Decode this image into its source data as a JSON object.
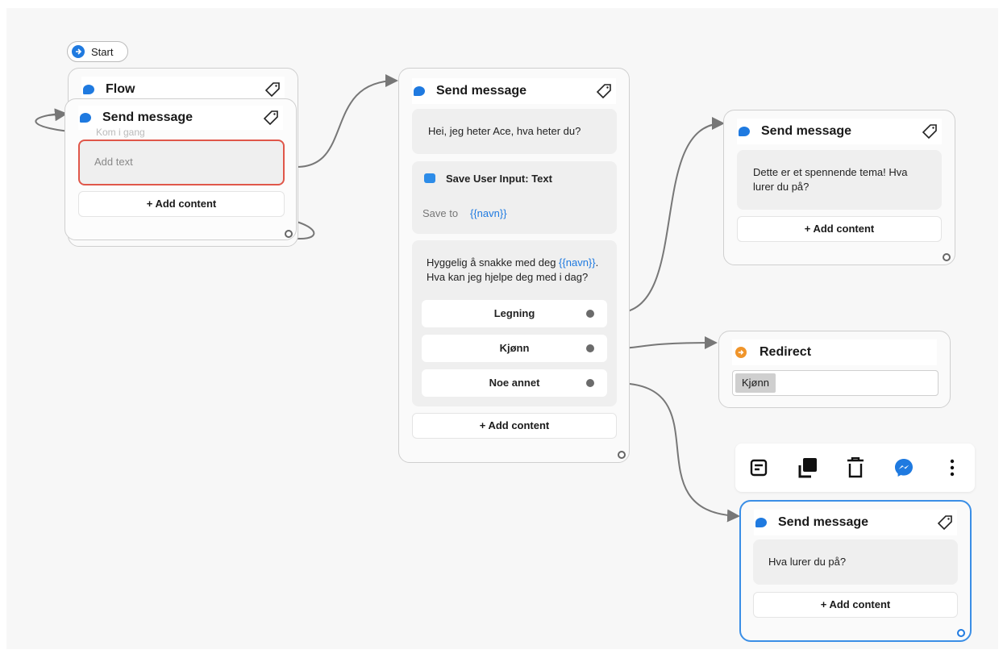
{
  "start": {
    "label": "Start"
  },
  "flow_node": {
    "title": "Flow",
    "ghost_text": "Kom i gang",
    "inner": {
      "title": "Send message",
      "input_placeholder": "Add text",
      "add_label": "+ Add content"
    }
  },
  "main_node": {
    "title": "Send message",
    "message": "Hei, jeg heter Ace, hva heter du?",
    "save_input": {
      "title": "Save User Input: Text",
      "save_to_label": "Save to",
      "variable": "{{navn}}"
    },
    "question": {
      "text_before": "Hyggelig å snakke med deg ",
      "variable": "{{navn}}",
      "text_after": ". Hva kan jeg hjelpe deg med i dag?"
    },
    "choices": [
      "Legning",
      "Kjønn",
      "Noe annet"
    ],
    "add_label": "+ Add content"
  },
  "right_top_node": {
    "title": "Send message",
    "message": "Dette er et spennende tema! Hva lurer du på?",
    "add_label": "+ Add content"
  },
  "redirect_node": {
    "title": "Redirect",
    "target": "Kjønn"
  },
  "toolbar": {
    "items": [
      "note-icon",
      "duplicate-icon",
      "delete-icon",
      "messenger-icon",
      "more-icon"
    ],
    "accent": "#1f7ae0"
  },
  "bottom_node": {
    "title": "Send message",
    "message": "Hva lurer du på?",
    "add_label": "+ Add content"
  },
  "colors": {
    "accent": "#1f7ae0",
    "selected_border": "#3a8ee6",
    "error_border": "#e0574a",
    "redirect": "#f0952b"
  }
}
